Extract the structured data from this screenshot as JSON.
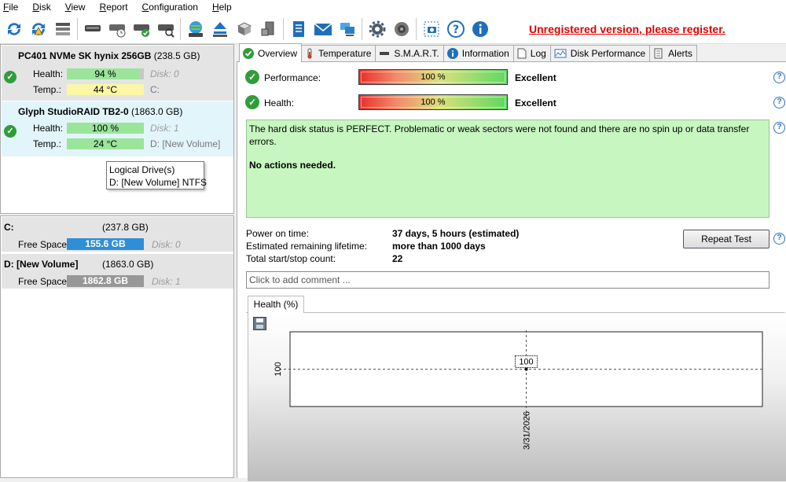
{
  "menu": [
    "File",
    "Disk",
    "View",
    "Report",
    "Configuration",
    "Help"
  ],
  "menu_mnemonic": [
    "F",
    "D",
    "V",
    "R",
    "C",
    "H"
  ],
  "toolbar_icons": [
    "refresh-icon",
    "refresh-warning-icon",
    "disk-list-icon",
    "disk-icon",
    "disk-clock-icon",
    "disk-check-icon",
    "disk-search-icon",
    "globe-disk-icon",
    "eject-icon",
    "server-icon",
    "server-down-icon",
    "notepad-icon",
    "mail-icon",
    "network-icon",
    "settings-gear-icon",
    "speaker-icon",
    "screenshot-icon",
    "help-icon",
    "info-icon"
  ],
  "register_text": "Unregistered version, please register.",
  "disks": [
    {
      "name_bold": "PC401 NVMe SK hynix 256GB",
      "size": "(238.5 GB)",
      "health_label": "Health:",
      "health": "94 %",
      "health_pct": 94,
      "disk": "Disk: 0",
      "temp_label": "Temp.:",
      "temp": "44 °C",
      "drive": "C:"
    },
    {
      "name_bold": "Glyph   StudioRAID TB2-0",
      "size": "(1863.0 GB)",
      "health_label": "Health:",
      "health": "100 %",
      "health_pct": 100,
      "disk": "Disk: 1",
      "temp_label": "Temp.:",
      "temp": "24 °C",
      "drive": "D: [New Volume]"
    }
  ],
  "tooltip": {
    "line1": "Logical Drive(s)",
    "line2": "D: [New Volume] NTFS"
  },
  "volumes": [
    {
      "title": "C:",
      "size": "(237.8 GB)",
      "free_label": "Free Space",
      "free": "155.6 GB",
      "disk": "Disk: 0",
      "color": "#2f8fd6"
    },
    {
      "title": "D: [New Volume]",
      "size": "(1863.0 GB)",
      "free_label": "Free Space",
      "free": "1862.8 GB",
      "disk": "Disk: 1",
      "color": "#979797"
    }
  ],
  "tabs": [
    "Overview",
    "Temperature",
    "S.M.A.R.T.",
    "Information",
    "Log",
    "Disk Performance",
    "Alerts"
  ],
  "tab_icons": [
    "check-icon",
    "thermometer-icon",
    "smart-icon",
    "info-icon",
    "log-icon",
    "performance-icon",
    "alerts-icon"
  ],
  "overview": {
    "performance_label": "Performance:",
    "performance_value": "100 %",
    "performance_rating": "Excellent",
    "health_label": "Health:",
    "health_value": "100 %",
    "health_rating": "Excellent",
    "status_text": "The hard disk status is PERFECT. Problematic or weak sectors were not found and there are no spin up or data transfer errors.",
    "status_action": "No actions needed.",
    "power_on_label": "Power on time:",
    "power_on_value": "37 days, 5 hours (estimated)",
    "lifetime_label": "Estimated remaining lifetime:",
    "lifetime_value": "more than 1000 days",
    "startstop_label": "Total start/stop count:",
    "startstop_value": "22",
    "repeat_button": "Repeat Test",
    "comment_placeholder": "Click to add comment ..."
  },
  "health_tab": "Health (%)",
  "chart_data": {
    "type": "line",
    "x": [
      "3/31/2026"
    ],
    "series": [
      {
        "values": [
          100
        ]
      }
    ],
    "data_labels": [
      "100"
    ],
    "y_tick_labels": [
      "100"
    ],
    "grid": true
  }
}
